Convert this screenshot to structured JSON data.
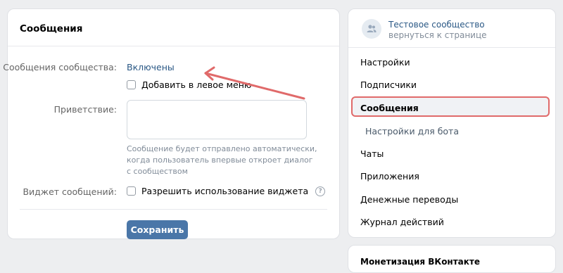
{
  "main": {
    "title": "Сообщения",
    "messages_label": "Сообщения сообщества:",
    "messages_value": "Включены",
    "add_left_menu": "Добавить в левое меню",
    "greeting_label": "Приветствие:",
    "greeting_value": "",
    "hint_lines": [
      "Сообщение будет отправлено автоматически,",
      "когда пользователь впервые откроет диалог",
      "с сообществом"
    ],
    "widget_label": "Виджет сообщений:",
    "widget_checkbox": "Разрешить использование виджета",
    "help_glyph": "?",
    "save_button": "Сохранить"
  },
  "sidebar": {
    "community_name": "Тестовое сообщество",
    "back_link": "вернуться к странице",
    "items": [
      {
        "label": "Настройки"
      },
      {
        "label": "Подписчики"
      },
      {
        "label": "Сообщения",
        "active": true
      },
      {
        "label": "Настройки для бота",
        "sub": true
      },
      {
        "label": "Чаты"
      },
      {
        "label": "Приложения"
      },
      {
        "label": "Денежные переводы"
      },
      {
        "label": "Журнал действий"
      }
    ]
  },
  "sidebar2": {
    "title": "Монетизация ВКонтакте"
  },
  "colors": {
    "accent": "#4a76a8",
    "link": "#2a5885",
    "annotation": "#e06a6a"
  }
}
